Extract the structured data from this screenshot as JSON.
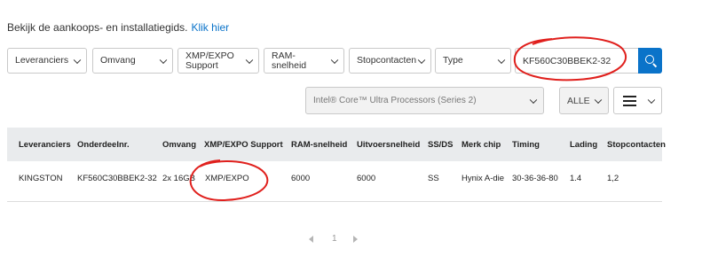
{
  "guide": {
    "text": "Bekijk de aankoops- en installatiegids.",
    "link": "Klik hier"
  },
  "filters": {
    "supplier": "Leveranciers",
    "size": "Omvang",
    "xmp_line1": "XMP/EXPO",
    "xmp_line2": "Support",
    "ram_speed": "RAM-snelheid",
    "sockets": "Stopcontacten",
    "type": "Type"
  },
  "search": {
    "value": "KF560C30BBEK2-32",
    "icon": "search-icon"
  },
  "secondary": {
    "processor": "Intel® Core™ Ultra Processors (Series 2)",
    "all": "ALLE",
    "view_icon": "list-view-icon"
  },
  "table": {
    "headers": {
      "supplier": "Leveranciers",
      "part": "Onderdeelnr.",
      "size": "Omvang",
      "xmp": "XMP/EXPO Support",
      "ram": "RAM-snelheid",
      "out": "Uitvoersnelheid",
      "ssds": "SS/DS",
      "chip": "Merk chip",
      "timing": "Timing",
      "load": "Lading",
      "sockets": "Stopcontacten"
    },
    "row": {
      "supplier": "KINGSTON",
      "part": "KF560C30BBEK2-32",
      "size": "2x 16GB",
      "xmp": "XMP/EXPO",
      "ram": "6000",
      "out": "6000",
      "ssds": "SS",
      "chip": "Hynix A-die",
      "timing": "30-36-36-80",
      "load": "1.4",
      "sockets": "1,2"
    }
  },
  "pagination": {
    "page": "1"
  },
  "colors": {
    "accent": "#0a73c9",
    "annotation": "#e0201d",
    "header_bg": "#e9ebed"
  }
}
